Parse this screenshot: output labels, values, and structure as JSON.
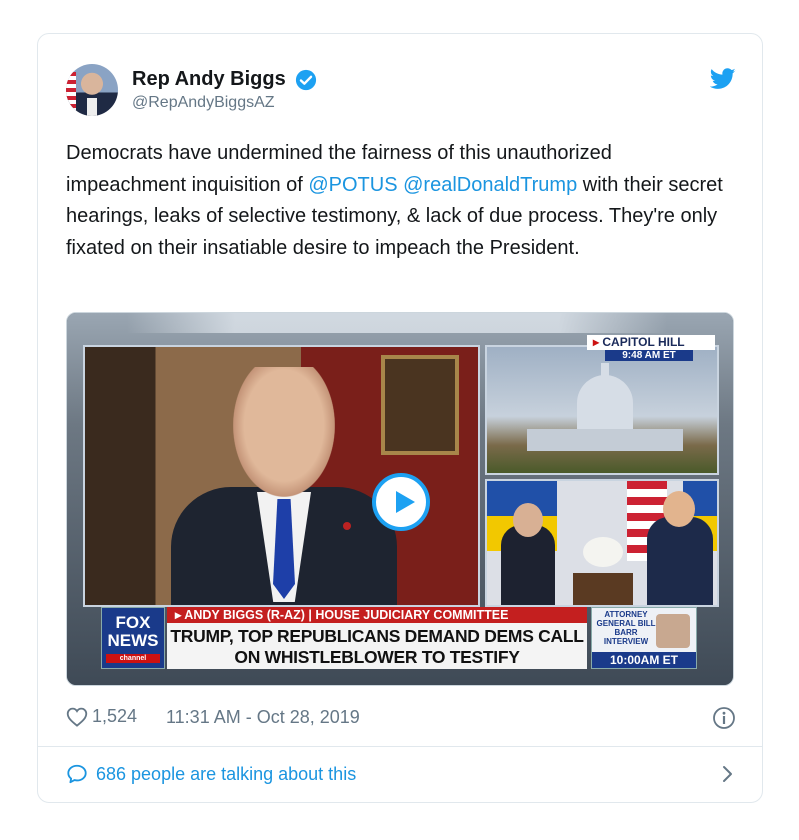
{
  "author": {
    "name": "Rep Andy Biggs",
    "handle": "@RepAndyBiggsAZ",
    "verified": true
  },
  "tweet": {
    "text_parts": [
      "Democrats have undermined the fairness of this unauthorized impeachment inquisition of ",
      "@POTUS",
      " ",
      "@realDonaldTrump",
      " with their secret hearings, leaks of selective testimony, & lack of due process. They're only fixated on their insatiable desire to impeach the President."
    ]
  },
  "video": {
    "capitol_label": "CAPITOL HILL",
    "capitol_time": "9:48 AM ET",
    "network_logo": "FOX NEWS",
    "network_sub": "channel",
    "chyron_strip": "ANDY BIGGS (R-AZ) | HOUSE JUDICIARY COMMITTEE",
    "chyron_headline": "TRUMP, TOP REPUBLICANS DEMAND DEMS CALL ON WHISTLEBLOWER TO TESTIFY",
    "promo_text": "ATTORNEY GENERAL BILL BARR INTERVIEW",
    "promo_time": "10:00AM ET"
  },
  "meta": {
    "likes": "1,524",
    "timestamp": "11:31 AM - Oct 28, 2019"
  },
  "footer": {
    "talking": "686 people are talking about this"
  },
  "icons": {
    "verified": "verified-badge-icon",
    "brand": "twitter-bird-icon",
    "like": "heart-icon",
    "info": "info-icon",
    "reply": "speech-bubble-icon",
    "chevron": "chevron-right-icon"
  },
  "colors": {
    "link": "#1b95e0",
    "brand": "#1da1f2",
    "muted": "#657786",
    "border": "#e1e8ed"
  }
}
